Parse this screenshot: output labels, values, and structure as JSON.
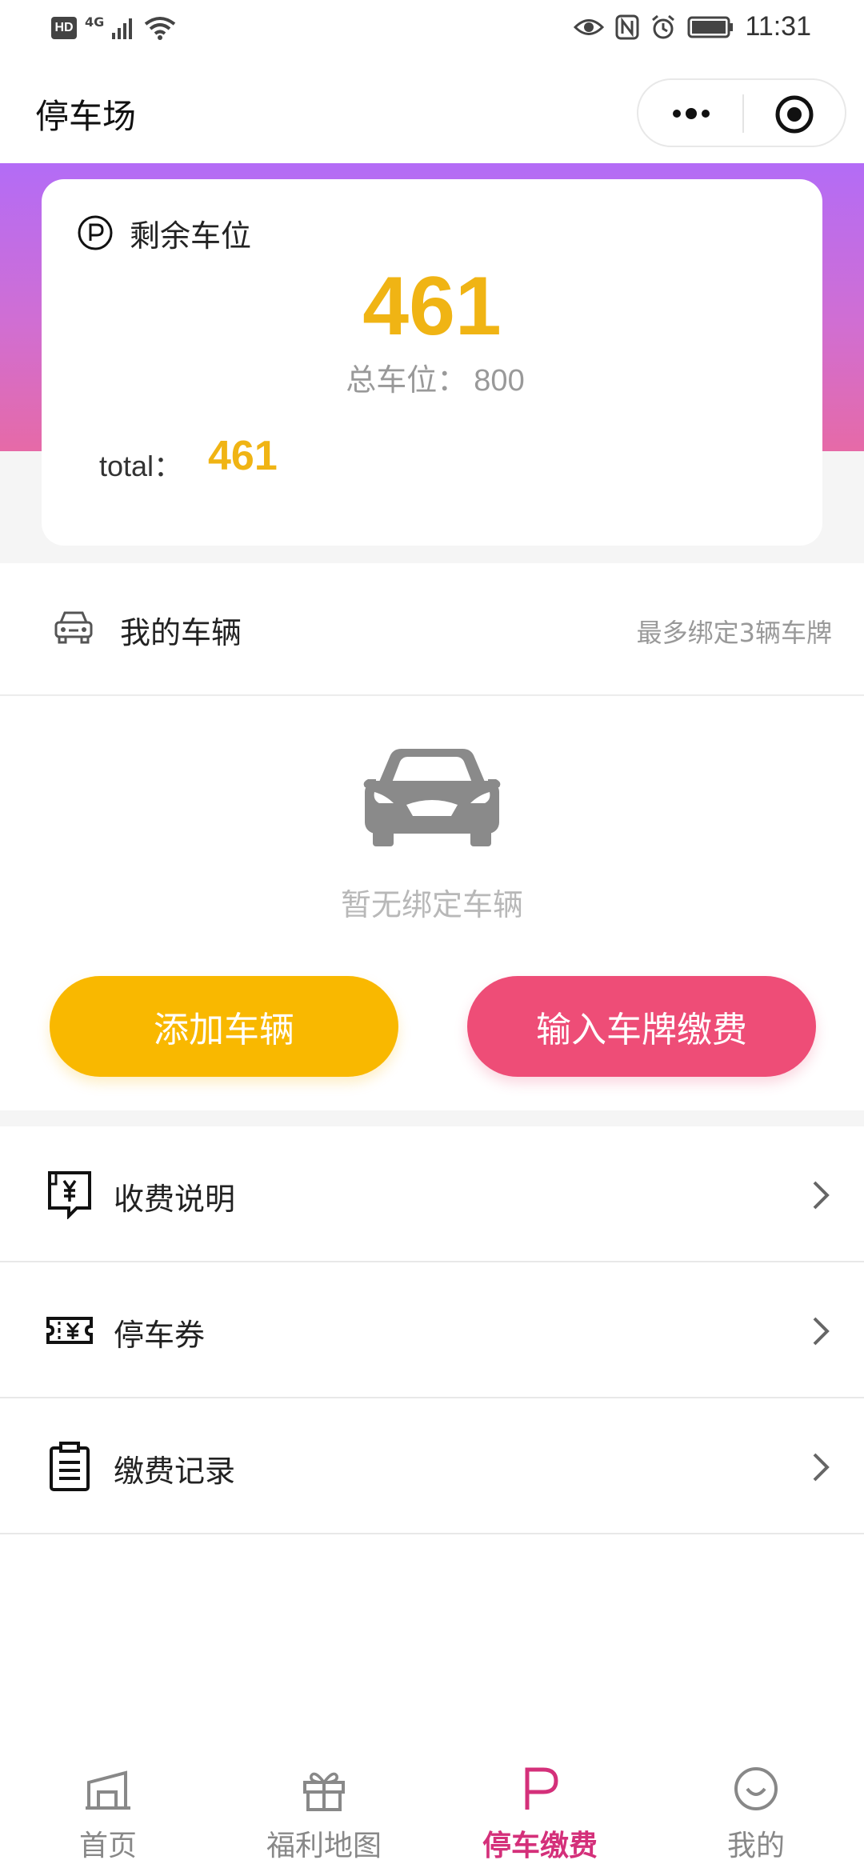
{
  "status_bar": {
    "hd": "HD",
    "network": "4G",
    "time": "11:31"
  },
  "nav": {
    "title": "停车场"
  },
  "parking_card": {
    "label": "剩余车位",
    "remaining": "461",
    "total_label": "总车位：",
    "total_value": "800",
    "small_label": "total：",
    "small_value": "461"
  },
  "vehicles": {
    "title": "我的车辆",
    "hint": "最多绑定3辆车牌",
    "empty_text": "暂无绑定车辆",
    "add_button": "添加车辆",
    "pay_button": "输入车牌缴费"
  },
  "menu": [
    {
      "label": "收费说明",
      "icon": "fee-receipt-icon"
    },
    {
      "label": "停车券",
      "icon": "parking-coupon-icon"
    },
    {
      "label": "缴费记录",
      "icon": "payment-record-icon"
    }
  ],
  "tabs": [
    {
      "label": "首页",
      "icon": "home-icon"
    },
    {
      "label": "福利地图",
      "icon": "gift-icon"
    },
    {
      "label": "停车缴费",
      "icon": "parking-p-icon",
      "active": true
    },
    {
      "label": "我的",
      "icon": "smile-profile-icon"
    }
  ],
  "colors": {
    "accent_yellow": "#f9b800",
    "accent_pink": "#ee4d77",
    "active_tab": "#d4307a",
    "gradient_top": "#b36cf6",
    "gradient_bottom": "#e66aa7"
  }
}
